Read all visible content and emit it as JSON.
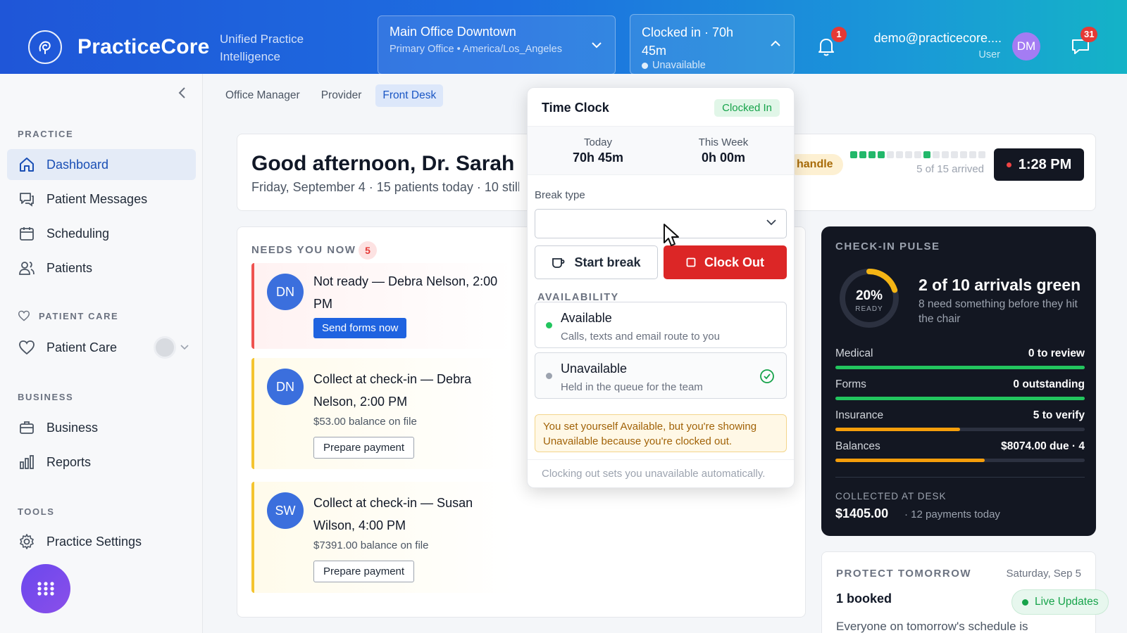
{
  "header": {
    "brand": "PracticeCore",
    "brand_sub": "Unified Practice Intelligence",
    "office": {
      "name": "Main Office Downtown",
      "sub": "Primary Office • America/Los_Angeles"
    },
    "clock": {
      "title": "Clocked in · 70h 45m",
      "status": "Unavailable"
    },
    "notifications_count": "1",
    "user_email": "demo@practicecore....",
    "user_role": "User",
    "avatar_initials": "DM",
    "messages_count": "31"
  },
  "sidebar": {
    "sections": {
      "practice": "PRACTICE",
      "patient_care": "PATIENT CARE",
      "business": "BUSINESS",
      "tools": "TOOLS"
    },
    "items": {
      "dashboard": "Dashboard",
      "patient_messages": "Patient Messages",
      "scheduling": "Scheduling",
      "patients": "Patients",
      "patient_care": "Patient Care",
      "business": "Business",
      "reports": "Reports",
      "practice_settings": "Practice Settings"
    }
  },
  "role_tabs": [
    "Office Manager",
    "Provider",
    "Front Desk"
  ],
  "greeting": {
    "title": "Good afternoon, Dr. Sarah",
    "subtitle": "Friday, September 4 · 15 patients today · 10 still t",
    "handle": "handle",
    "arrived_text": "5 of 15 arrived",
    "time": "1:28 PM"
  },
  "needs": {
    "label": "NEEDS YOU NOW",
    "count": "5",
    "tasks": [
      {
        "initials": "DN",
        "title": "Not ready — Debra Nelson, 2:00 PM",
        "action": "Send forms now"
      },
      {
        "initials": "DN",
        "title": "Collect at check-in — Debra Nelson, 2:00 PM",
        "sub": "$53.00 balance on file",
        "action": "Prepare payment"
      },
      {
        "initials": "SW",
        "title": "Collect at check-in — Susan Wilson, 4:00 PM",
        "sub": "$7391.00 balance on file",
        "action": "Prepare payment"
      }
    ]
  },
  "pulse": {
    "label": "CHECK-IN PULSE",
    "ring_pct": "20%",
    "ring_value": 0.2,
    "ring_sub": "READY",
    "headline": "2 of 10 arrivals green",
    "desc": "8 need something before they hit the chair",
    "metrics": [
      {
        "name": "Medical",
        "value": "0 to review",
        "fill": 1.0,
        "color": "#22c55e"
      },
      {
        "name": "Forms",
        "value": "0 outstanding",
        "fill": 1.0,
        "color": "#22c55e"
      },
      {
        "name": "Insurance",
        "value": "5 to verify",
        "fill": 0.5,
        "color": "#f59e0b"
      },
      {
        "name": "Balances",
        "value": "$8074.00 due · 4",
        "fill": 0.6,
        "color": "#f59e0b"
      }
    ],
    "collected_label": "COLLECTED AT DESK",
    "collected_value": "$1405.00",
    "collected_sub": "· 12 payments today"
  },
  "protect": {
    "label": "PROTECT TOMORROW",
    "date": "Saturday, Sep 5",
    "booked": "1 booked",
    "desc": "Everyone on tomorrow's schedule is"
  },
  "live_updates": "Live Updates",
  "time_clock": {
    "title": "Time Clock",
    "badge": "Clocked In",
    "today_label": "Today",
    "today_value": "70h 45m",
    "week_label": "This Week",
    "week_value": "0h 00m",
    "break_label": "Break type",
    "start_break": "Start break",
    "clock_out": "Clock Out",
    "availability_label": "AVAILABILITY",
    "available_title": "Available",
    "available_desc": "Calls, texts and email route to you",
    "unavailable_title": "Unavailable",
    "unavailable_desc": "Held in the queue for the team",
    "warning": "You set yourself Available, but you're showing Unavailable because you're clocked out.",
    "footer": "Clocking out sets you unavailable automatically."
  },
  "colors": {
    "accent": "#1f63e0",
    "danger": "#dc2626",
    "success": "#16a34a",
    "warning": "#f59e0b"
  }
}
